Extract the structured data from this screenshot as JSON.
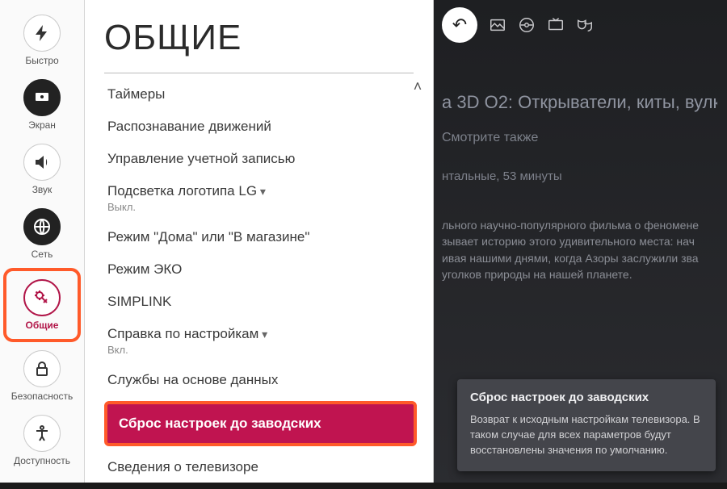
{
  "sidebar": {
    "items": [
      {
        "label": "Быстро",
        "icon": "bolt-icon"
      },
      {
        "label": "Экран",
        "icon": "screen-icon"
      },
      {
        "label": "Звук",
        "icon": "speaker-icon"
      },
      {
        "label": "Сеть",
        "icon": "globe-icon"
      },
      {
        "label": "Общие",
        "icon": "gear-wrench-icon",
        "selected": true,
        "highlight": true
      },
      {
        "label": "Безопасность",
        "icon": "lock-icon"
      },
      {
        "label": "Доступность",
        "icon": "accessibility-icon"
      }
    ]
  },
  "panel": {
    "title": "ОБЩИЕ",
    "rows": [
      {
        "label": "Таймеры"
      },
      {
        "label": "Распознавание движений"
      },
      {
        "label": "Управление учетной записью"
      },
      {
        "label": "Подсветка логотипа LG",
        "sub": "Выкл.",
        "chevron": true
      },
      {
        "label": "Режим \"Дома\" или \"В магазине\""
      },
      {
        "label": "Режим ЭКО"
      },
      {
        "label": "SIMPLINK"
      },
      {
        "label": "Справка по настройкам",
        "sub": "Вкл.",
        "chevron": true
      },
      {
        "label": "Службы на основе данных"
      },
      {
        "label": "Сброс настроек до заводских",
        "highlight": true
      },
      {
        "label": "Сведения о телевизоре"
      }
    ]
  },
  "background": {
    "title_fragment": "a 3D O2: Открыватели, киты, вулк",
    "see_also": "Смотрите также",
    "meta": "нтальные, 53 минуты",
    "description_lines": [
      "льного научно-популярного фильма о феномене",
      "зывает историю этого удивительного места: нач",
      "ивая нашими днями, когда Азоры заслужили зва",
      "уголков природы на нашей планете."
    ]
  },
  "tooltip": {
    "title": "Сброс настроек до заводских",
    "body": "Возврат к исходным настройкам телевизора. В таком случае для всех параметров будут восстановлены значения по умолчанию."
  },
  "topbar_icons": [
    "photo-icon",
    "disc-icon",
    "tv-icon",
    "masks-icon"
  ]
}
